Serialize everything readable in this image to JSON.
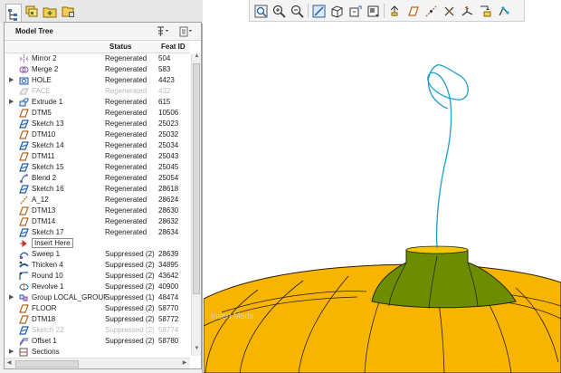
{
  "panel_tabs": [
    {
      "icon": "model-tree-icon"
    },
    {
      "icon": "layers-icon"
    },
    {
      "icon": "folder-add-icon"
    },
    {
      "icon": "favorites-icon"
    }
  ],
  "tree": {
    "title": "Model Tree",
    "settings_icon": "tree-settings-icon",
    "filter_icon": "show-filter-icon",
    "columns": {
      "status": "Status",
      "feat_id": "Feat ID"
    },
    "rows": [
      {
        "expander": "",
        "icon": "mirror-icon",
        "name": "Mirror 2",
        "status": "Regenerated",
        "feat_id": "504"
      },
      {
        "expander": "",
        "icon": "merge-icon",
        "name": "Merge 2",
        "status": "Regenerated",
        "feat_id": "583"
      },
      {
        "expander": "▶",
        "icon": "hole-icon",
        "name": "HOLE",
        "status": "Regenerated",
        "feat_id": "4423"
      },
      {
        "expander": "",
        "icon": "face-icon",
        "name": "FACE",
        "status": "Regenerated",
        "feat_id": "432"
      },
      {
        "expander": "▶",
        "icon": "extrude-icon",
        "name": "Extrude 1",
        "status": "Regenerated",
        "feat_id": "615"
      },
      {
        "expander": "",
        "icon": "datum-plane-icon",
        "name": "DTM5",
        "status": "Regenerated",
        "feat_id": "10506"
      },
      {
        "expander": "",
        "icon": "sketch-icon",
        "name": "Sketch 13",
        "status": "Regenerated",
        "feat_id": "25023"
      },
      {
        "expander": "",
        "icon": "datum-plane-icon",
        "name": "DTM10",
        "status": "Regenerated",
        "feat_id": "25032"
      },
      {
        "expander": "",
        "icon": "sketch-icon",
        "name": "Sketch 14",
        "status": "Regenerated",
        "feat_id": "25034"
      },
      {
        "expander": "",
        "icon": "datum-plane-icon",
        "name": "DTM11",
        "status": "Regenerated",
        "feat_id": "25043"
      },
      {
        "expander": "",
        "icon": "sketch-icon",
        "name": "Sketch 15",
        "status": "Regenerated",
        "feat_id": "25045"
      },
      {
        "expander": "",
        "icon": "blend-icon",
        "name": "Blend 2",
        "status": "Regenerated",
        "feat_id": "25054"
      },
      {
        "expander": "",
        "icon": "sketch-icon",
        "name": "Sketch 16",
        "status": "Regenerated",
        "feat_id": "28618"
      },
      {
        "expander": "",
        "icon": "datum-axis-icon",
        "name": "A_12",
        "status": "Regenerated",
        "feat_id": "28624"
      },
      {
        "expander": "",
        "icon": "datum-plane-icon",
        "name": "DTM13",
        "status": "Regenerated",
        "feat_id": "28630"
      },
      {
        "expander": "",
        "icon": "datum-plane-icon",
        "name": "DTM14",
        "status": "Regenerated",
        "feat_id": "28632"
      },
      {
        "expander": "",
        "icon": "sketch-icon",
        "name": "Sketch 17",
        "status": "Regenerated",
        "feat_id": "28634"
      },
      {
        "expander": "",
        "icon": "insert-arrow-icon",
        "name": "Insert Here",
        "status": "",
        "feat_id": ""
      },
      {
        "expander": "",
        "icon": "sweep-icon",
        "name": "Sweep 1",
        "status": "Suppressed (2)",
        "feat_id": "28639"
      },
      {
        "expander": "",
        "icon": "thicken-icon",
        "name": "Thicken 4",
        "status": "Suppressed (2)",
        "feat_id": "34895"
      },
      {
        "expander": "",
        "icon": "round-icon",
        "name": "Round 10",
        "status": "Suppressed (2)",
        "feat_id": "43642"
      },
      {
        "expander": "",
        "icon": "revolve-icon",
        "name": "Revolve 1",
        "status": "Suppressed (2)",
        "feat_id": "40900"
      },
      {
        "expander": "▶",
        "icon": "group-icon",
        "name": "Group LOCAL_GROUP",
        "status": "Suppressed (1)",
        "feat_id": "48474"
      },
      {
        "expander": "",
        "icon": "datum-plane-icon",
        "name": "FLOOR",
        "status": "Suppressed (2)",
        "feat_id": "58770"
      },
      {
        "expander": "",
        "icon": "datum-plane-icon",
        "name": "DTM18",
        "status": "Suppressed (2)",
        "feat_id": "58772"
      },
      {
        "expander": "",
        "icon": "sketch-icon",
        "name": "Sketch 22",
        "status": "Suppressed (2)",
        "feat_id": "58774"
      },
      {
        "expander": "",
        "icon": "offset-icon",
        "name": "Offset 1",
        "status": "Suppressed (2)",
        "feat_id": "58780"
      },
      {
        "expander": "▶",
        "icon": "sections-icon",
        "name": "Sections",
        "status": "",
        "feat_id": ""
      }
    ]
  },
  "graphics_toolbar": [
    {
      "icon": "refit-icon"
    },
    {
      "icon": "zoom-in-icon"
    },
    {
      "icon": "zoom-out-icon"
    },
    {
      "icon": "repaint-icon"
    },
    {
      "icon": "named-views-icon"
    },
    {
      "icon": "saved-orientations-icon"
    },
    {
      "icon": "display-style-icon"
    },
    {
      "icon": "view-manager-icon"
    },
    {
      "icon": "plane-display-icon"
    },
    {
      "icon": "axis-display-icon"
    },
    {
      "icon": "point-display-icon"
    },
    {
      "icon": "csys-display-icon"
    },
    {
      "icon": "spin-center-icon"
    }
  ],
  "graphics": {
    "watermark": "Insert Mode"
  },
  "colors": {
    "pumpkin_fill": "#f7b500",
    "pumpkin_edge": "#2b1d00",
    "stem_fill": "#6e8c00",
    "curve": "#1e9fcf"
  }
}
